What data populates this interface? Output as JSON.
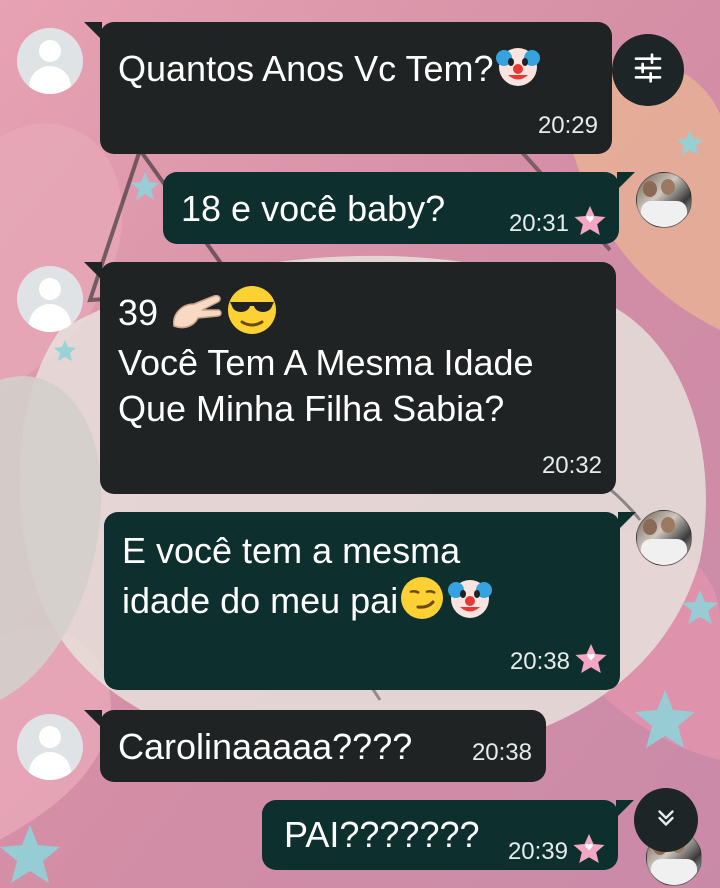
{
  "chat": {
    "messages": [
      {
        "direction": "incoming",
        "text": "Quantos Anos Vc Tem?",
        "emoji": "clown",
        "time": "20:29"
      },
      {
        "direction": "outgoing",
        "text": "18 e você baby?",
        "time": "20:31",
        "starred": true
      },
      {
        "direction": "incoming",
        "line1_text": "39",
        "line1_emoji": [
          "pinching-hand",
          "sunglasses-face"
        ],
        "line2": "Você Tem A Mesma Idade",
        "line3": "Que Minha Filha Sabia?",
        "time": "20:32"
      },
      {
        "direction": "outgoing",
        "line1": "E você tem a mesma",
        "line2_text": "idade do meu pai",
        "line2_emoji": [
          "smirk-face",
          "clown"
        ],
        "time": "20:38",
        "starred": true
      },
      {
        "direction": "incoming",
        "text": "Carolinaaaaa????",
        "time": "20:38"
      },
      {
        "direction": "outgoing",
        "text": "PAI???????",
        "time": "20:39",
        "starred": true
      }
    ]
  },
  "controls": {
    "filter_icon": "tune-sliders-icon",
    "scroll_down_icon": "double-chevron-down-icon"
  },
  "colors": {
    "incoming_bubble": "#1f2323",
    "outgoing_bubble": "#0d2f2e",
    "star_badge": "#f4a6c4",
    "wallpaper": "#d98ea6"
  }
}
